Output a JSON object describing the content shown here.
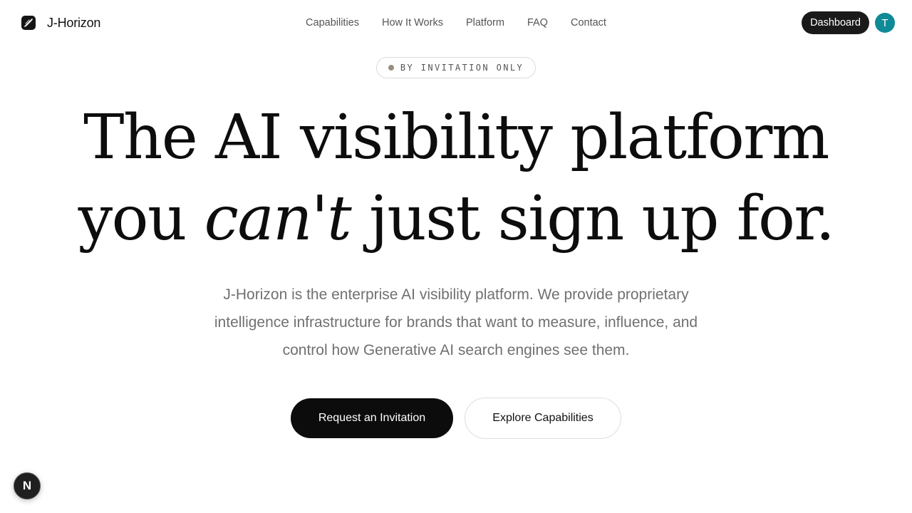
{
  "header": {
    "brand_name": "J-Horizon",
    "logo_icon": "feather-icon",
    "nav": [
      {
        "label": "Capabilities"
      },
      {
        "label": "How It Works"
      },
      {
        "label": "Platform"
      },
      {
        "label": "FAQ"
      },
      {
        "label": "Contact"
      }
    ],
    "dashboard_label": "Dashboard",
    "avatar_initial": "T",
    "avatar_color": "#0f8a97"
  },
  "hero": {
    "badge": "BY INVITATION ONLY",
    "headline_line1": "The AI visibility platform",
    "headline_line2_start": "you ",
    "headline_line2_emphasis": "can't",
    "headline_line2_end": " just sign up for.",
    "subtitle": "J-Horizon is the enterprise AI visibility platform. We provide proprietary intelligence infrastructure for brands that want to measure, influence, and control how Generative AI search engines see them.",
    "primary_cta": "Request an Invitation",
    "secondary_cta": "Explore Capabilities"
  },
  "dev_indicator": {
    "label": "N"
  },
  "colors": {
    "text": "#0d0d0d",
    "muted": "#707070",
    "button_dark": "#0c0c0c",
    "badge_dot": "#9a8e80"
  }
}
